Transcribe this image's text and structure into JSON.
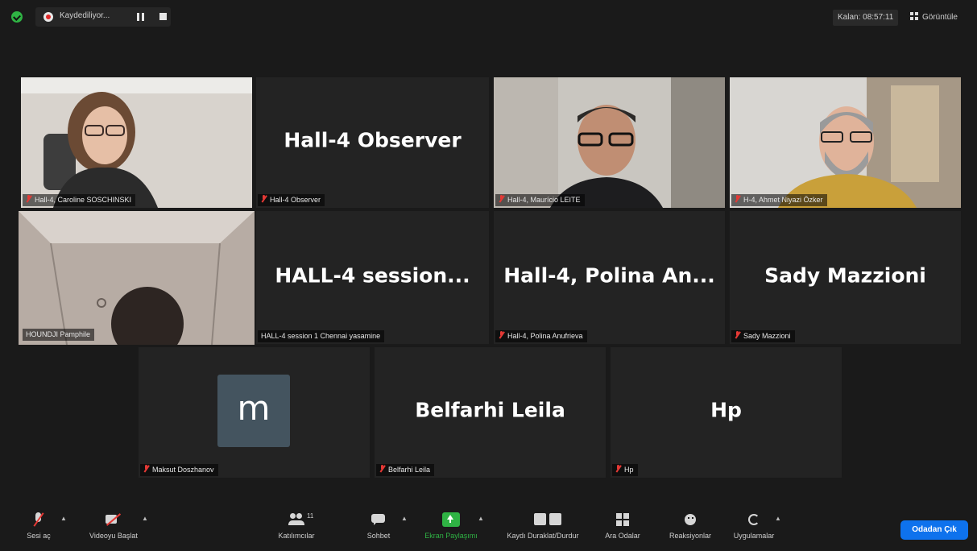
{
  "topbar": {
    "recording_label": "Kaydediliyor...",
    "remaining_time": "Kalan: 08:57:11",
    "view_label": "Görüntüle"
  },
  "tiles": [
    {
      "name_label": "Hall-4, Caroline SOSCHINSKI",
      "big_name": "",
      "muted": true
    },
    {
      "name_label": "Hall-4 Observer",
      "big_name": "Hall-4 Observer",
      "muted": true
    },
    {
      "name_label": "Hall-4, Maurício LEITE",
      "big_name": "",
      "muted": true
    },
    {
      "name_label": "H-4, Ahmet Niyazi Özker",
      "big_name": "",
      "muted": true
    },
    {
      "name_label": "HOUNDJI Pamphile",
      "big_name": "",
      "muted": false,
      "active_speaker": true
    },
    {
      "name_label": "HALL-4 session 1 Chennai yasamine",
      "big_name": "HALL-4  session...",
      "muted": false
    },
    {
      "name_label": "Hall-4, Polina Anufrieva",
      "big_name": "Hall-4,  Polina  An...",
      "muted": true
    },
    {
      "name_label": "Sady Mazzioni",
      "big_name": "Sady Mazzioni",
      "muted": true
    },
    {
      "name_label": "Maksut Doszhanov",
      "big_name": "",
      "avatar_letter": "m",
      "muted": true
    },
    {
      "name_label": "Belfarhi Leila",
      "big_name": "Belfarhi Leila",
      "muted": true
    },
    {
      "name_label": "Hp",
      "big_name": "Hp",
      "muted": true
    }
  ],
  "toolbar": {
    "unmute": "Sesi aç",
    "start_video": "Videoyu Başlat",
    "participants": "Katılımcılar",
    "participants_count": "11",
    "chat": "Sohbet",
    "share_screen": "Ekran Paylaşımı",
    "pause_stop_recording": "Kaydı Duraklat/Durdur",
    "breakout_rooms": "Ara Odalar",
    "reactions": "Reaksiyonlar",
    "apps": "Uygulamalar",
    "leave": "Odadan Çık"
  },
  "colors": {
    "active_speaker_border": "#c4e35a",
    "share_green": "#2fb344",
    "leave_blue": "#0e72ed",
    "muted_red": "#e53935"
  }
}
